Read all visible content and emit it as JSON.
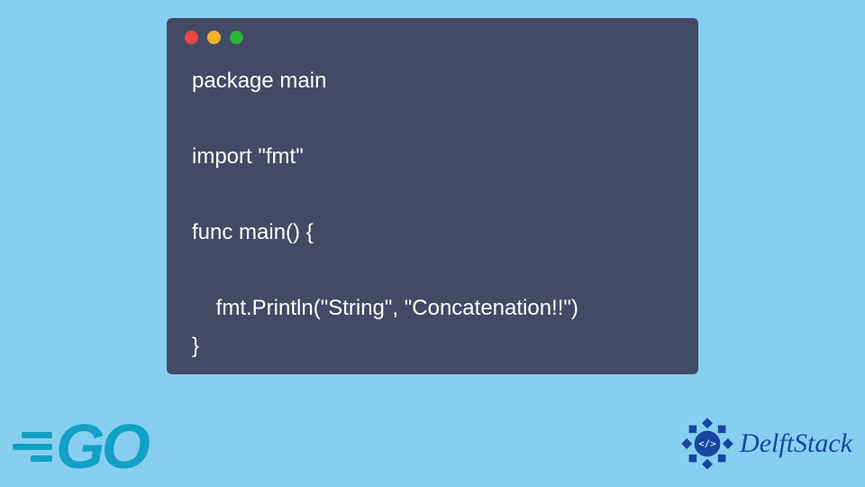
{
  "editor": {
    "window_controls": [
      "close",
      "minimize",
      "maximize"
    ],
    "code_lines": [
      "package main",
      "",
      "import \"fmt\"",
      "",
      "func main() {",
      "",
      "    fmt.Println(\"String\", \"Concatenation!!\")",
      "}"
    ]
  },
  "branding": {
    "go_logo_text": "GO",
    "delftstack_text": "DelftStack",
    "delftstack_icon_glyph": "</>"
  },
  "colors": {
    "page_bg": "#87cff0",
    "editor_bg": "#434a65",
    "code_fg": "#ffffff",
    "go_brand": "#12a0c4",
    "delft_brand": "#1646a0"
  }
}
